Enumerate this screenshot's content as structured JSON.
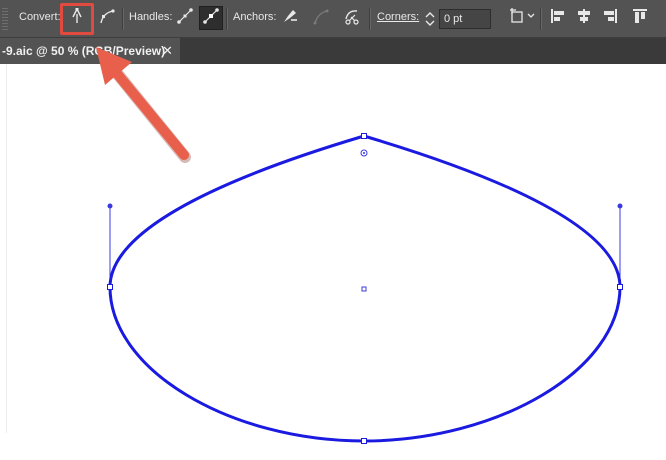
{
  "control_bar": {
    "convert_label": "Convert:",
    "handles_label": "Handles:",
    "anchors_label": "Anchors:",
    "corners_label": "Corners:",
    "corners_value": "0 pt",
    "buttons": [
      {
        "name": "convert-to-corner-icon",
        "state": "highlighted"
      },
      {
        "name": "convert-to-smooth-icon"
      },
      {
        "name": "show-handles-icon"
      },
      {
        "name": "hide-handles-icon",
        "state": "pressed"
      },
      {
        "name": "remove-anchor-icon"
      },
      {
        "name": "connect-endpoints-icon"
      },
      {
        "name": "cut-path-icon"
      },
      {
        "name": "corners-stepper-icon"
      },
      {
        "name": "transform-icon"
      },
      {
        "name": "align-left-icon"
      },
      {
        "name": "align-horizontal-center-icon"
      },
      {
        "name": "align-right-icon"
      },
      {
        "name": "align-top-icon"
      }
    ]
  },
  "document_tab": {
    "label": "-9.aic @ 50 % (RGB/Preview)",
    "close": "✕"
  },
  "annotation": {
    "highlight_color": "#e04a3f",
    "arrow_color": "#e8604c",
    "target": "convert-to-corner-button"
  },
  "artwork": {
    "shape": "teardrop-path",
    "stroke_color": "#1a1ae0",
    "anchor_points": [
      "top",
      "left",
      "right",
      "bottom"
    ],
    "handle_points": [
      "top-left",
      "top-right"
    ]
  }
}
